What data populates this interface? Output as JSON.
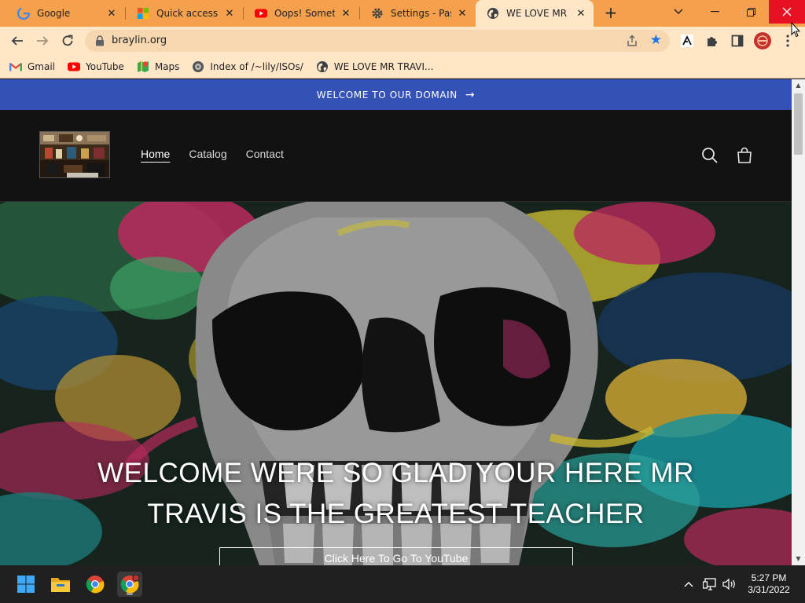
{
  "browser": {
    "tabs": [
      {
        "title": "Google",
        "favicon": "google-icon",
        "active": false
      },
      {
        "title": "Quick access to",
        "favicon": "windows-icon",
        "active": false
      },
      {
        "title": "Oops! Somethin",
        "favicon": "youtube-icon",
        "active": false
      },
      {
        "title": "Settings - Passw",
        "favicon": "gear-icon",
        "active": false
      },
      {
        "title": "WE LOVE MR TR",
        "favicon": "globe-icon",
        "active": true
      }
    ],
    "url": "braylin.org",
    "tab_strip_color": "#f5a04c",
    "toolbar_color": "#ffe6c7"
  },
  "bookmarks": [
    {
      "label": "Gmail",
      "icon": "gmail-icon"
    },
    {
      "label": "YouTube",
      "icon": "youtube-icon"
    },
    {
      "label": "Maps",
      "icon": "maps-icon"
    },
    {
      "label": "Index of /~lily/ISOs/",
      "icon": "site-icon"
    },
    {
      "label": "WE LOVE MR TRAVI...",
      "icon": "globe-icon"
    }
  ],
  "site": {
    "announcement": "WELCOME TO OUR DOMAIN",
    "announcement_color": "#3451b6",
    "nav": [
      {
        "label": "Home",
        "current": true
      },
      {
        "label": "Catalog",
        "current": false
      },
      {
        "label": "Contact",
        "current": false
      }
    ],
    "hero_title_line1": "WELCOME WERE SO GLAD YOUR HERE MR",
    "hero_title_line2": "TRAVIS IS THE GREATEST TEACHER",
    "hero_button": "Click Here To Go To YouTube"
  },
  "taskbar": {
    "apps": [
      "windows-start-icon",
      "file-explorer-icon",
      "chrome-icon",
      "chrome-profile-icon"
    ],
    "time": "5:27 PM",
    "date": "3/31/2022"
  }
}
